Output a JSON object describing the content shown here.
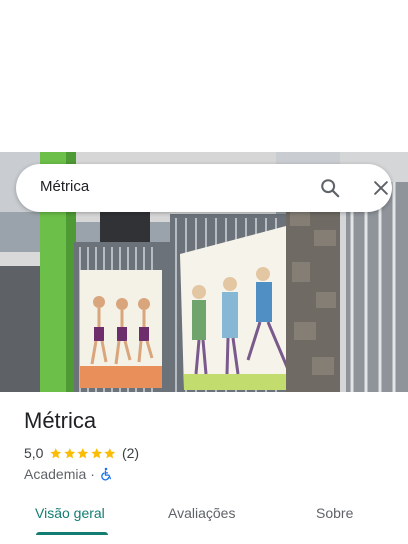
{
  "search": {
    "query": "Métrica"
  },
  "place": {
    "name": "Métrica",
    "rating": "5,0",
    "stars": 5,
    "review_count": "(2)",
    "category": "Academia",
    "separator": "·",
    "accessibility_icon": "wheelchair-icon"
  },
  "tabs": [
    {
      "label": "Visão geral",
      "active": true
    },
    {
      "label": "Avaliações",
      "active": false
    },
    {
      "label": "Sobre",
      "active": false
    }
  ],
  "colors": {
    "accent": "#137d72",
    "star": "#fbbc04",
    "accessibility": "#1a73e8"
  }
}
